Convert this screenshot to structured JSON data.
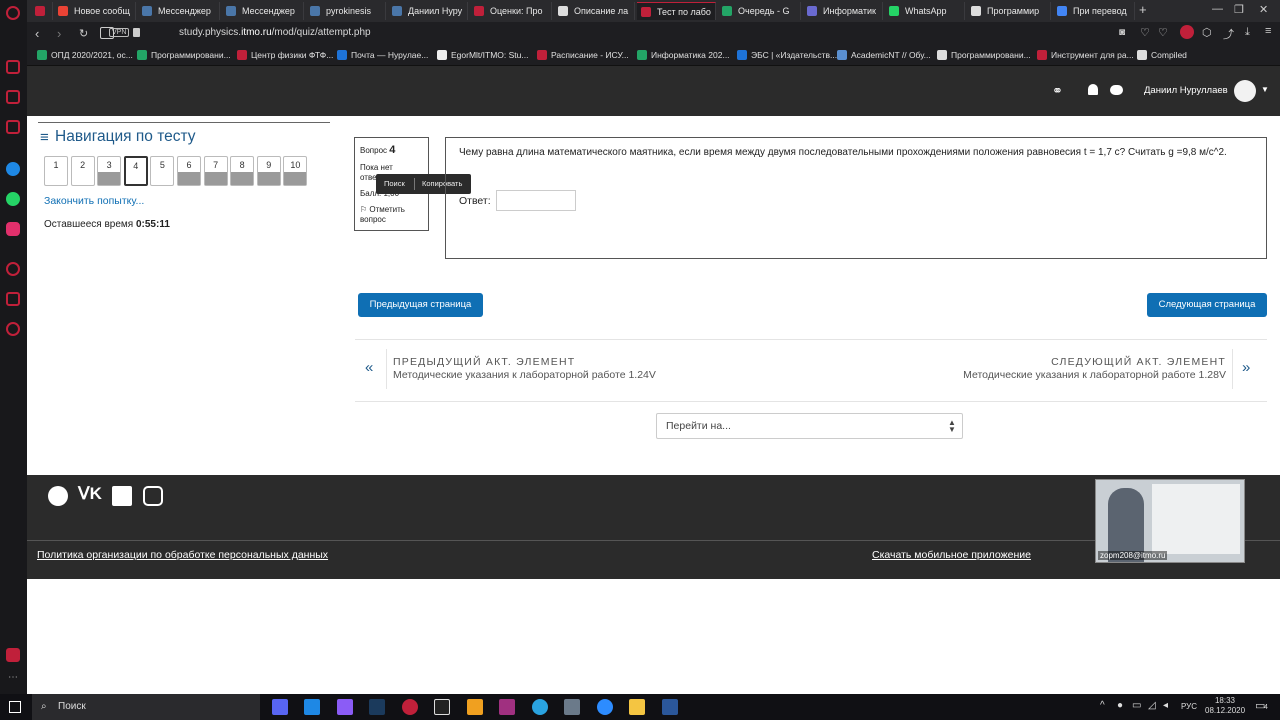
{
  "browser": {
    "tabs": [
      {
        "label": "",
        "color": "#c0203a"
      },
      {
        "label": "Новое сообщ",
        "color": "#ea4335"
      },
      {
        "label": "Мессенджер",
        "color": "#4a76a8"
      },
      {
        "label": "Мессенджер",
        "color": "#4a76a8"
      },
      {
        "label": "pyrokinesis",
        "color": "#4a76a8"
      },
      {
        "label": "Даниил Нуру",
        "color": "#4a76a8"
      },
      {
        "label": "Оценки: Про",
        "color": "#c0203a"
      },
      {
        "label": "Описание ла",
        "color": "#dddddd"
      },
      {
        "label": "Тест по лабо",
        "color": "#c0203a"
      },
      {
        "label": "Очередь - G",
        "color": "#23a566"
      },
      {
        "label": "Информатик",
        "color": "#6a6ad0"
      },
      {
        "label": "WhatsApp",
        "color": "#25d366"
      },
      {
        "label": "Программир",
        "color": "#dddddd"
      },
      {
        "label": "При перевод",
        "color": "#4285f4"
      }
    ],
    "vpn_label": "VPN",
    "url_prefix": "study.physics.",
    "url_host": "itmo.ru",
    "url_path": "/mod/quiz/attempt.php",
    "bookmarks": [
      {
        "label": "ОПД 2020/2021, ос...",
        "color": "#23a566"
      },
      {
        "label": "Программировани...",
        "color": "#23a566"
      },
      {
        "label": "Центр физики ФТФ...",
        "color": "#c0203a"
      },
      {
        "label": "Почта — Нурулае...",
        "color": "#1e73d8"
      },
      {
        "label": "EgorMlt/ITMO: Stu...",
        "color": "#eeeeee"
      },
      {
        "label": "Расписание - ИСУ...",
        "color": "#c0203a"
      },
      {
        "label": "Информатика 202...",
        "color": "#23a566"
      },
      {
        "label": "ЭБС | «Издательств...",
        "color": "#1e73d8"
      },
      {
        "label": "AcademicNT // Обу...",
        "color": "#5a8fd0"
      },
      {
        "label": "Программировани...",
        "color": "#dddddd"
      },
      {
        "label": "Инструмент для ра...",
        "color": "#c0203a"
      },
      {
        "label": "Compiled",
        "color": "#dddddd"
      }
    ]
  },
  "header": {
    "user_name": "Даниил Нуруллаев"
  },
  "nav": {
    "title": "Навигация по тесту",
    "questions": [
      {
        "num": "1",
        "answered": false
      },
      {
        "num": "2",
        "answered": false
      },
      {
        "num": "3",
        "answered": true
      },
      {
        "num": "4",
        "answered": false,
        "current": true
      },
      {
        "num": "5",
        "answered": false
      },
      {
        "num": "6",
        "answered": true
      },
      {
        "num": "7",
        "answered": true
      },
      {
        "num": "8",
        "answered": true
      },
      {
        "num": "9",
        "answered": true
      },
      {
        "num": "10",
        "answered": true
      }
    ],
    "finish_link": "Закончить попытку...",
    "time_label": "Оставшееся время",
    "time_value": "0:55:11"
  },
  "question": {
    "label": "Вопрос",
    "number": "4",
    "status": "Пока нет ответа",
    "score_prefix": "Балл: ",
    "score_suffix": "1,00",
    "flag_label": "Отметить вопрос",
    "text": "Чему равна длина математического маятника, если время между двумя последовательными прохождениями положения равновесия t = 1,7 с? Считать g =9,8 м/с^2.",
    "answer_label": "Ответ:",
    "answer_value": ""
  },
  "popup": {
    "search": "Поиск",
    "copy": "Копировать"
  },
  "buttons": {
    "prev_page": "Предыдущая страница",
    "next_page": "Следующая страница"
  },
  "activity_nav": {
    "prev_heading": "ПРЕДЫДУЩИЙ АКТ. ЭЛЕМЕНТ",
    "prev_title": "Методические указания к лабораторной работе 1.24V",
    "next_heading": "СЛЕДУЮЩИЙ АКТ. ЭЛЕМЕНТ",
    "next_title": "Методические указания к лабораторной работе 1.28V",
    "jump_placeholder": "Перейти на..."
  },
  "footer": {
    "privacy_link": "Политика организации по обработке персональных данных",
    "app_link": "Скачать мобильное приложение"
  },
  "video": {
    "caption": "zopm208@itmo.ru"
  },
  "taskbar": {
    "search_label": "Поиск",
    "lang": "РУС",
    "time": "18:33",
    "date": "08.12.2020",
    "notif_count": "4"
  }
}
